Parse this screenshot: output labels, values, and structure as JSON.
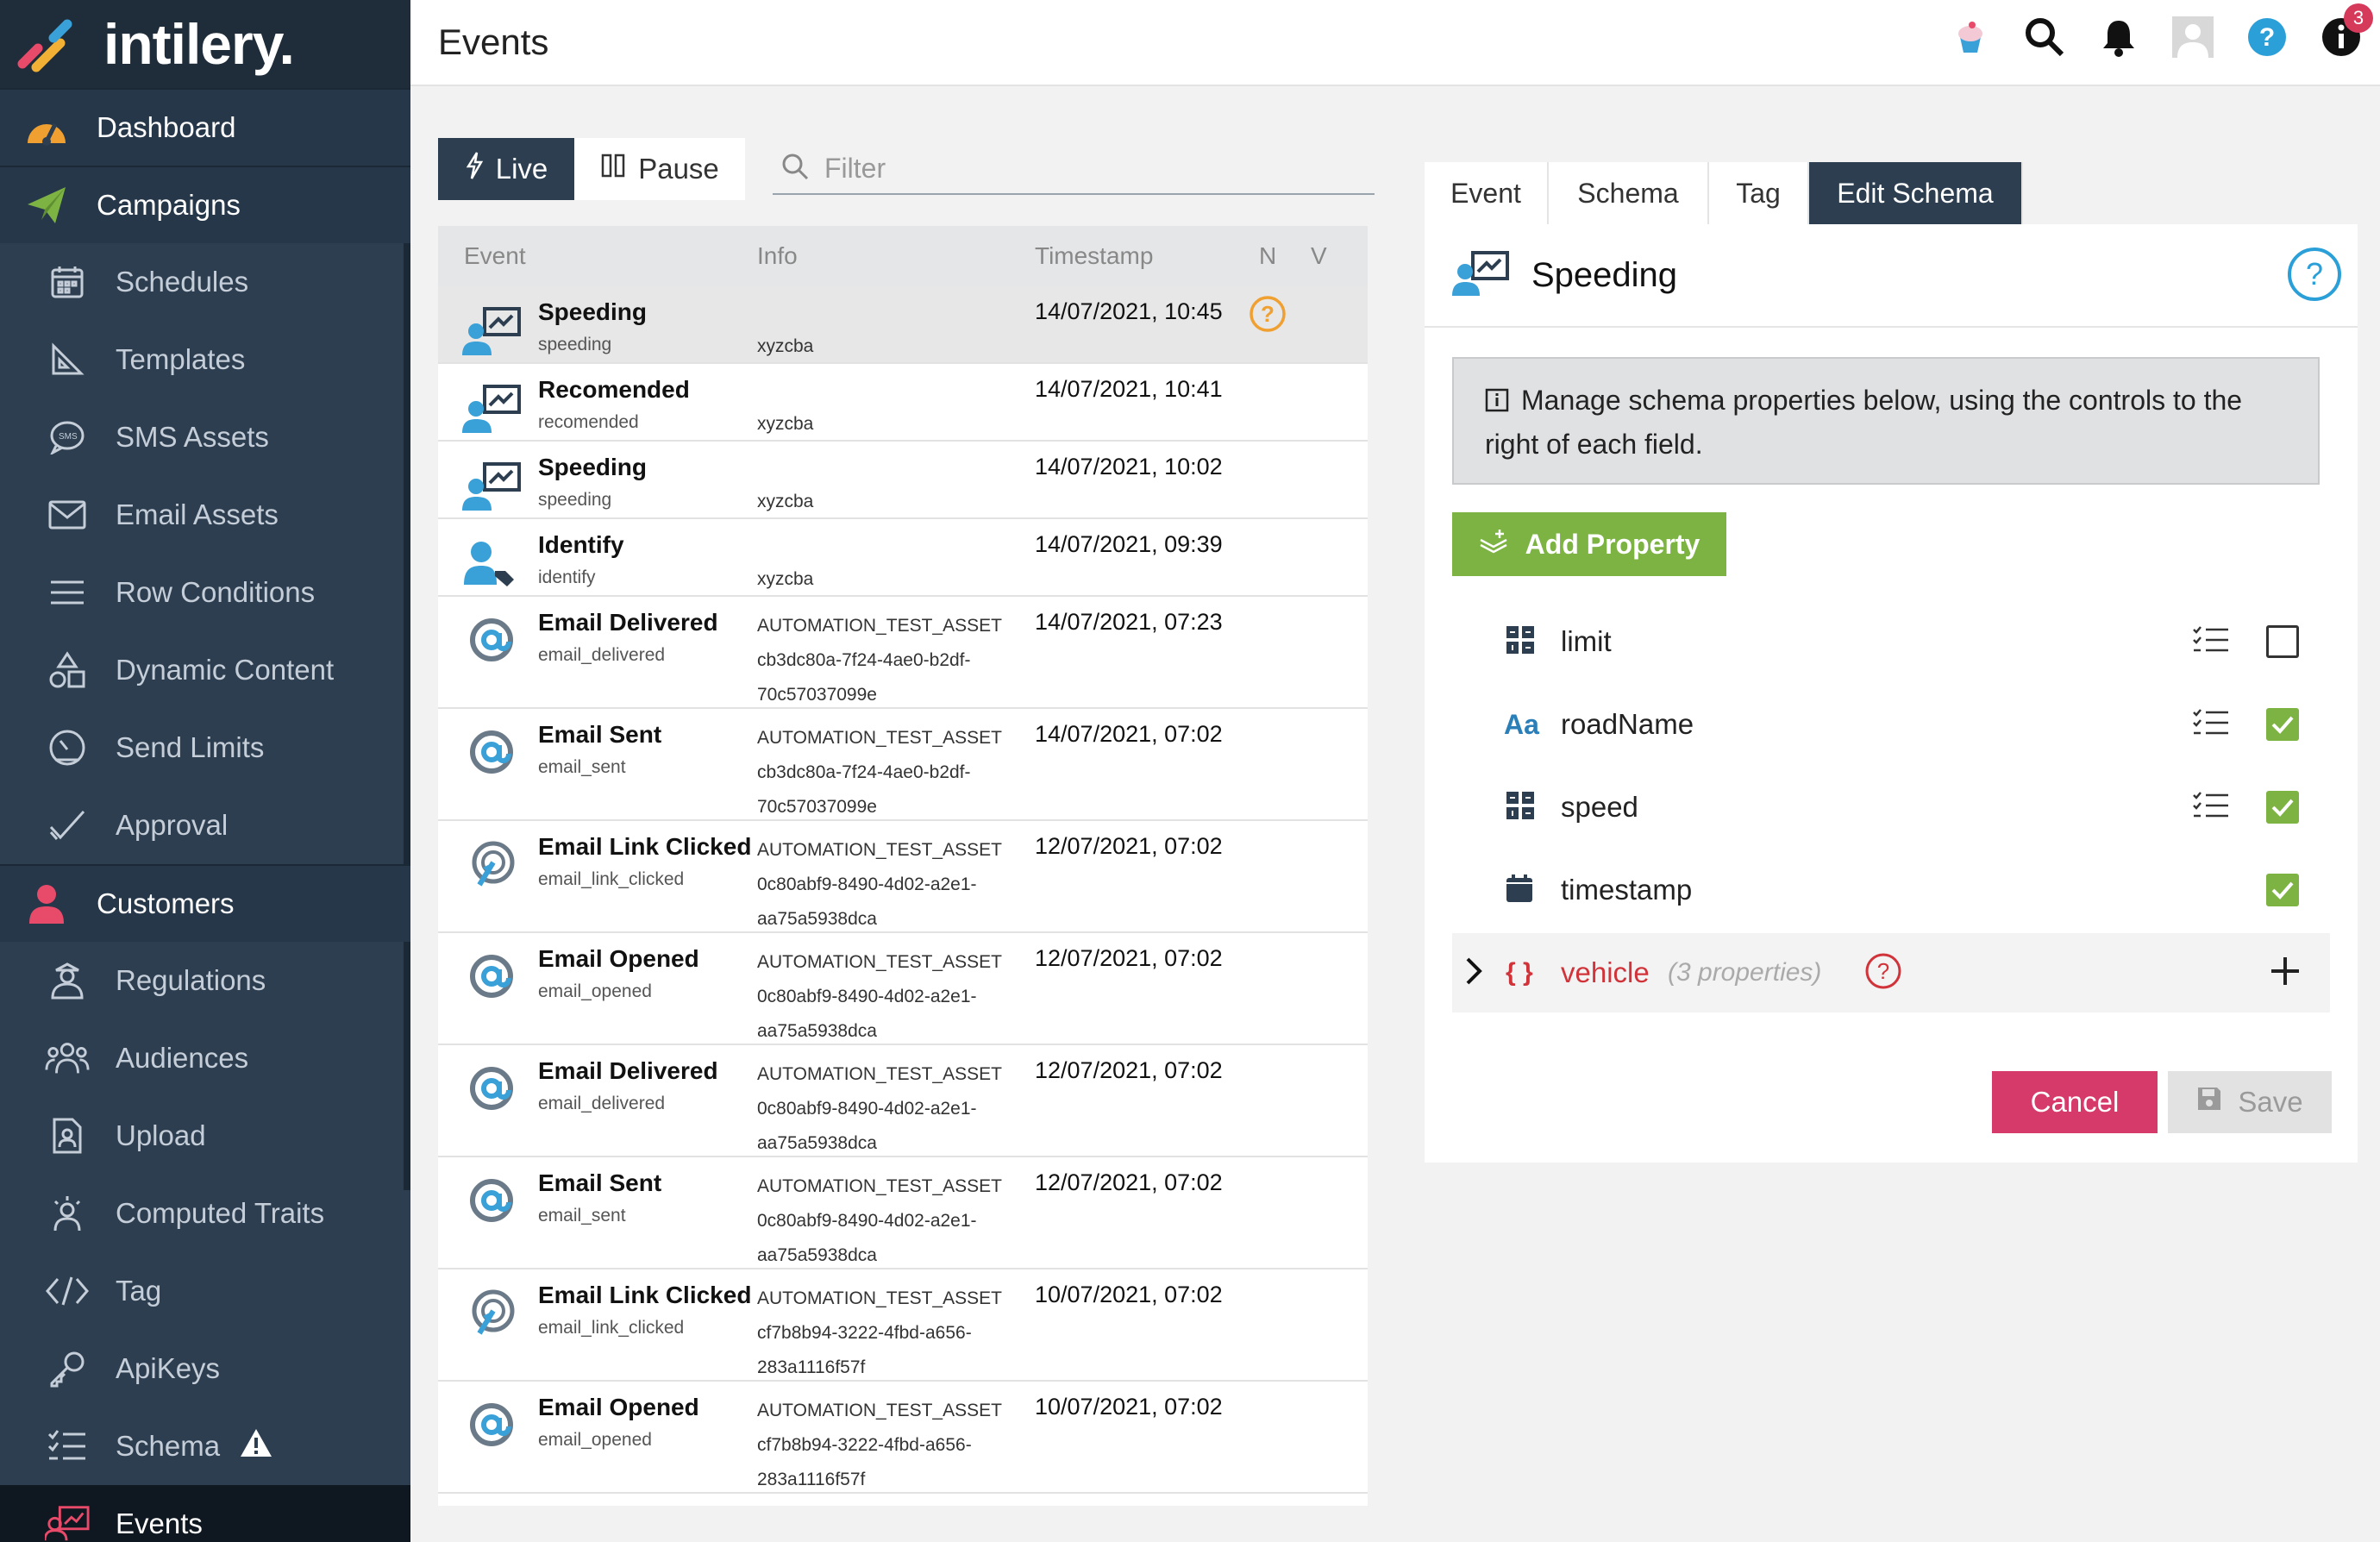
{
  "app": {
    "brand": "intilery.",
    "page_title": "Events",
    "notification_count": "3"
  },
  "colors": {
    "sidebar": "#2c3e50",
    "accent_green": "#7cb342",
    "accent_pink": "#d63a6a",
    "help_blue": "#2a9fd8",
    "warning_orange": "#f0a030"
  },
  "sidebar": {
    "dashboard": "Dashboard",
    "campaigns": "Campaigns",
    "campaign_items": [
      "Schedules",
      "Templates",
      "SMS Assets",
      "Email Assets",
      "Row Conditions",
      "Dynamic Content",
      "Send Limits",
      "Approval"
    ],
    "customers": "Customers",
    "customer_items": [
      "Regulations",
      "Audiences",
      "Upload",
      "Computed Traits",
      "Tag",
      "ApiKeys",
      "Schema"
    ],
    "events": "Events"
  },
  "controls": {
    "live_label": "Live",
    "pause_label": "Pause",
    "filter_placeholder": "Filter"
  },
  "table": {
    "headers": {
      "event": "Event",
      "info": "Info",
      "timestamp": "Timestamp",
      "n": "N",
      "v": "V"
    },
    "rows": [
      {
        "name": "Speeding",
        "id": "speeding",
        "info1": "",
        "info2": "xyzcba",
        "info3": "",
        "ts": "14/07/2021, 10:45",
        "icon": "user-chart-icon"
      },
      {
        "name": "Recomended",
        "id": "recomended",
        "info1": "",
        "info2": "xyzcba",
        "info3": "",
        "ts": "14/07/2021, 10:41",
        "icon": "user-chart-icon"
      },
      {
        "name": "Speeding",
        "id": "speeding",
        "info1": "",
        "info2": "xyzcba",
        "info3": "",
        "ts": "14/07/2021, 10:02",
        "icon": "user-chart-icon"
      },
      {
        "name": "Identify",
        "id": "identify",
        "info1": "",
        "info2": "xyzcba",
        "info3": "",
        "ts": "14/07/2021, 09:39",
        "icon": "user-tag-icon"
      },
      {
        "name": "Email Delivered",
        "id": "email_delivered",
        "info1": "AUTOMATION_TEST_ASSET",
        "info2": "cb3dc80a-7f24-4ae0-b2df-",
        "info3": "70c57037099e",
        "ts": "14/07/2021, 07:23",
        "icon": "at-icon"
      },
      {
        "name": "Email Sent",
        "id": "email_sent",
        "info1": "AUTOMATION_TEST_ASSET",
        "info2": "cb3dc80a-7f24-4ae0-b2df-",
        "info3": "70c57037099e",
        "ts": "14/07/2021, 07:02",
        "icon": "at-icon"
      },
      {
        "name": "Email Link Clicked",
        "id": "email_link_clicked",
        "info1": "AUTOMATION_TEST_ASSET",
        "info2": "0c80abf9-8490-4d02-a2e1-",
        "info3": "aa75a5938dca",
        "ts": "12/07/2021, 07:02",
        "icon": "link-click-icon"
      },
      {
        "name": "Email Opened",
        "id": "email_opened",
        "info1": "AUTOMATION_TEST_ASSET",
        "info2": "0c80abf9-8490-4d02-a2e1-",
        "info3": "aa75a5938dca",
        "ts": "12/07/2021, 07:02",
        "icon": "at-icon"
      },
      {
        "name": "Email Delivered",
        "id": "email_delivered",
        "info1": "AUTOMATION_TEST_ASSET",
        "info2": "0c80abf9-8490-4d02-a2e1-",
        "info3": "aa75a5938dca",
        "ts": "12/07/2021, 07:02",
        "icon": "at-icon"
      },
      {
        "name": "Email Sent",
        "id": "email_sent",
        "info1": "AUTOMATION_TEST_ASSET",
        "info2": "0c80abf9-8490-4d02-a2e1-",
        "info3": "aa75a5938dca",
        "ts": "12/07/2021, 07:02",
        "icon": "at-icon"
      },
      {
        "name": "Email Link Clicked",
        "id": "email_link_clicked",
        "info1": "AUTOMATION_TEST_ASSET",
        "info2": "cf7b8b94-3222-4fbd-a656-",
        "info3": "283a1116f57f",
        "ts": "10/07/2021, 07:02",
        "icon": "link-click-icon"
      },
      {
        "name": "Email Opened",
        "id": "email_opened",
        "info1": "AUTOMATION_TEST_ASSET",
        "info2": "cf7b8b94-3222-4fbd-a656-",
        "info3": "283a1116f57f",
        "ts": "10/07/2021, 07:02",
        "icon": "at-icon"
      }
    ]
  },
  "detail": {
    "tabs": [
      "Event",
      "Schema",
      "Tag",
      "Edit Schema"
    ],
    "active_tab": "Edit Schema",
    "title": "Speeding",
    "info_text": "Manage schema properties below, using the controls to the right of each field.",
    "add_property_label": "Add Property",
    "properties": [
      {
        "name": "limit",
        "type_icon": "number-grid-icon",
        "required": false
      },
      {
        "name": "roadName",
        "type_icon": "text-aa-icon",
        "required": true
      },
      {
        "name": "speed",
        "type_icon": "number-grid-icon",
        "required": true
      },
      {
        "name": "timestamp",
        "type_icon": "calendar-icon",
        "required": true
      }
    ],
    "object_property": {
      "name": "vehicle",
      "count_text": "(3 properties)"
    },
    "cancel_label": "Cancel",
    "save_label": "Save"
  }
}
